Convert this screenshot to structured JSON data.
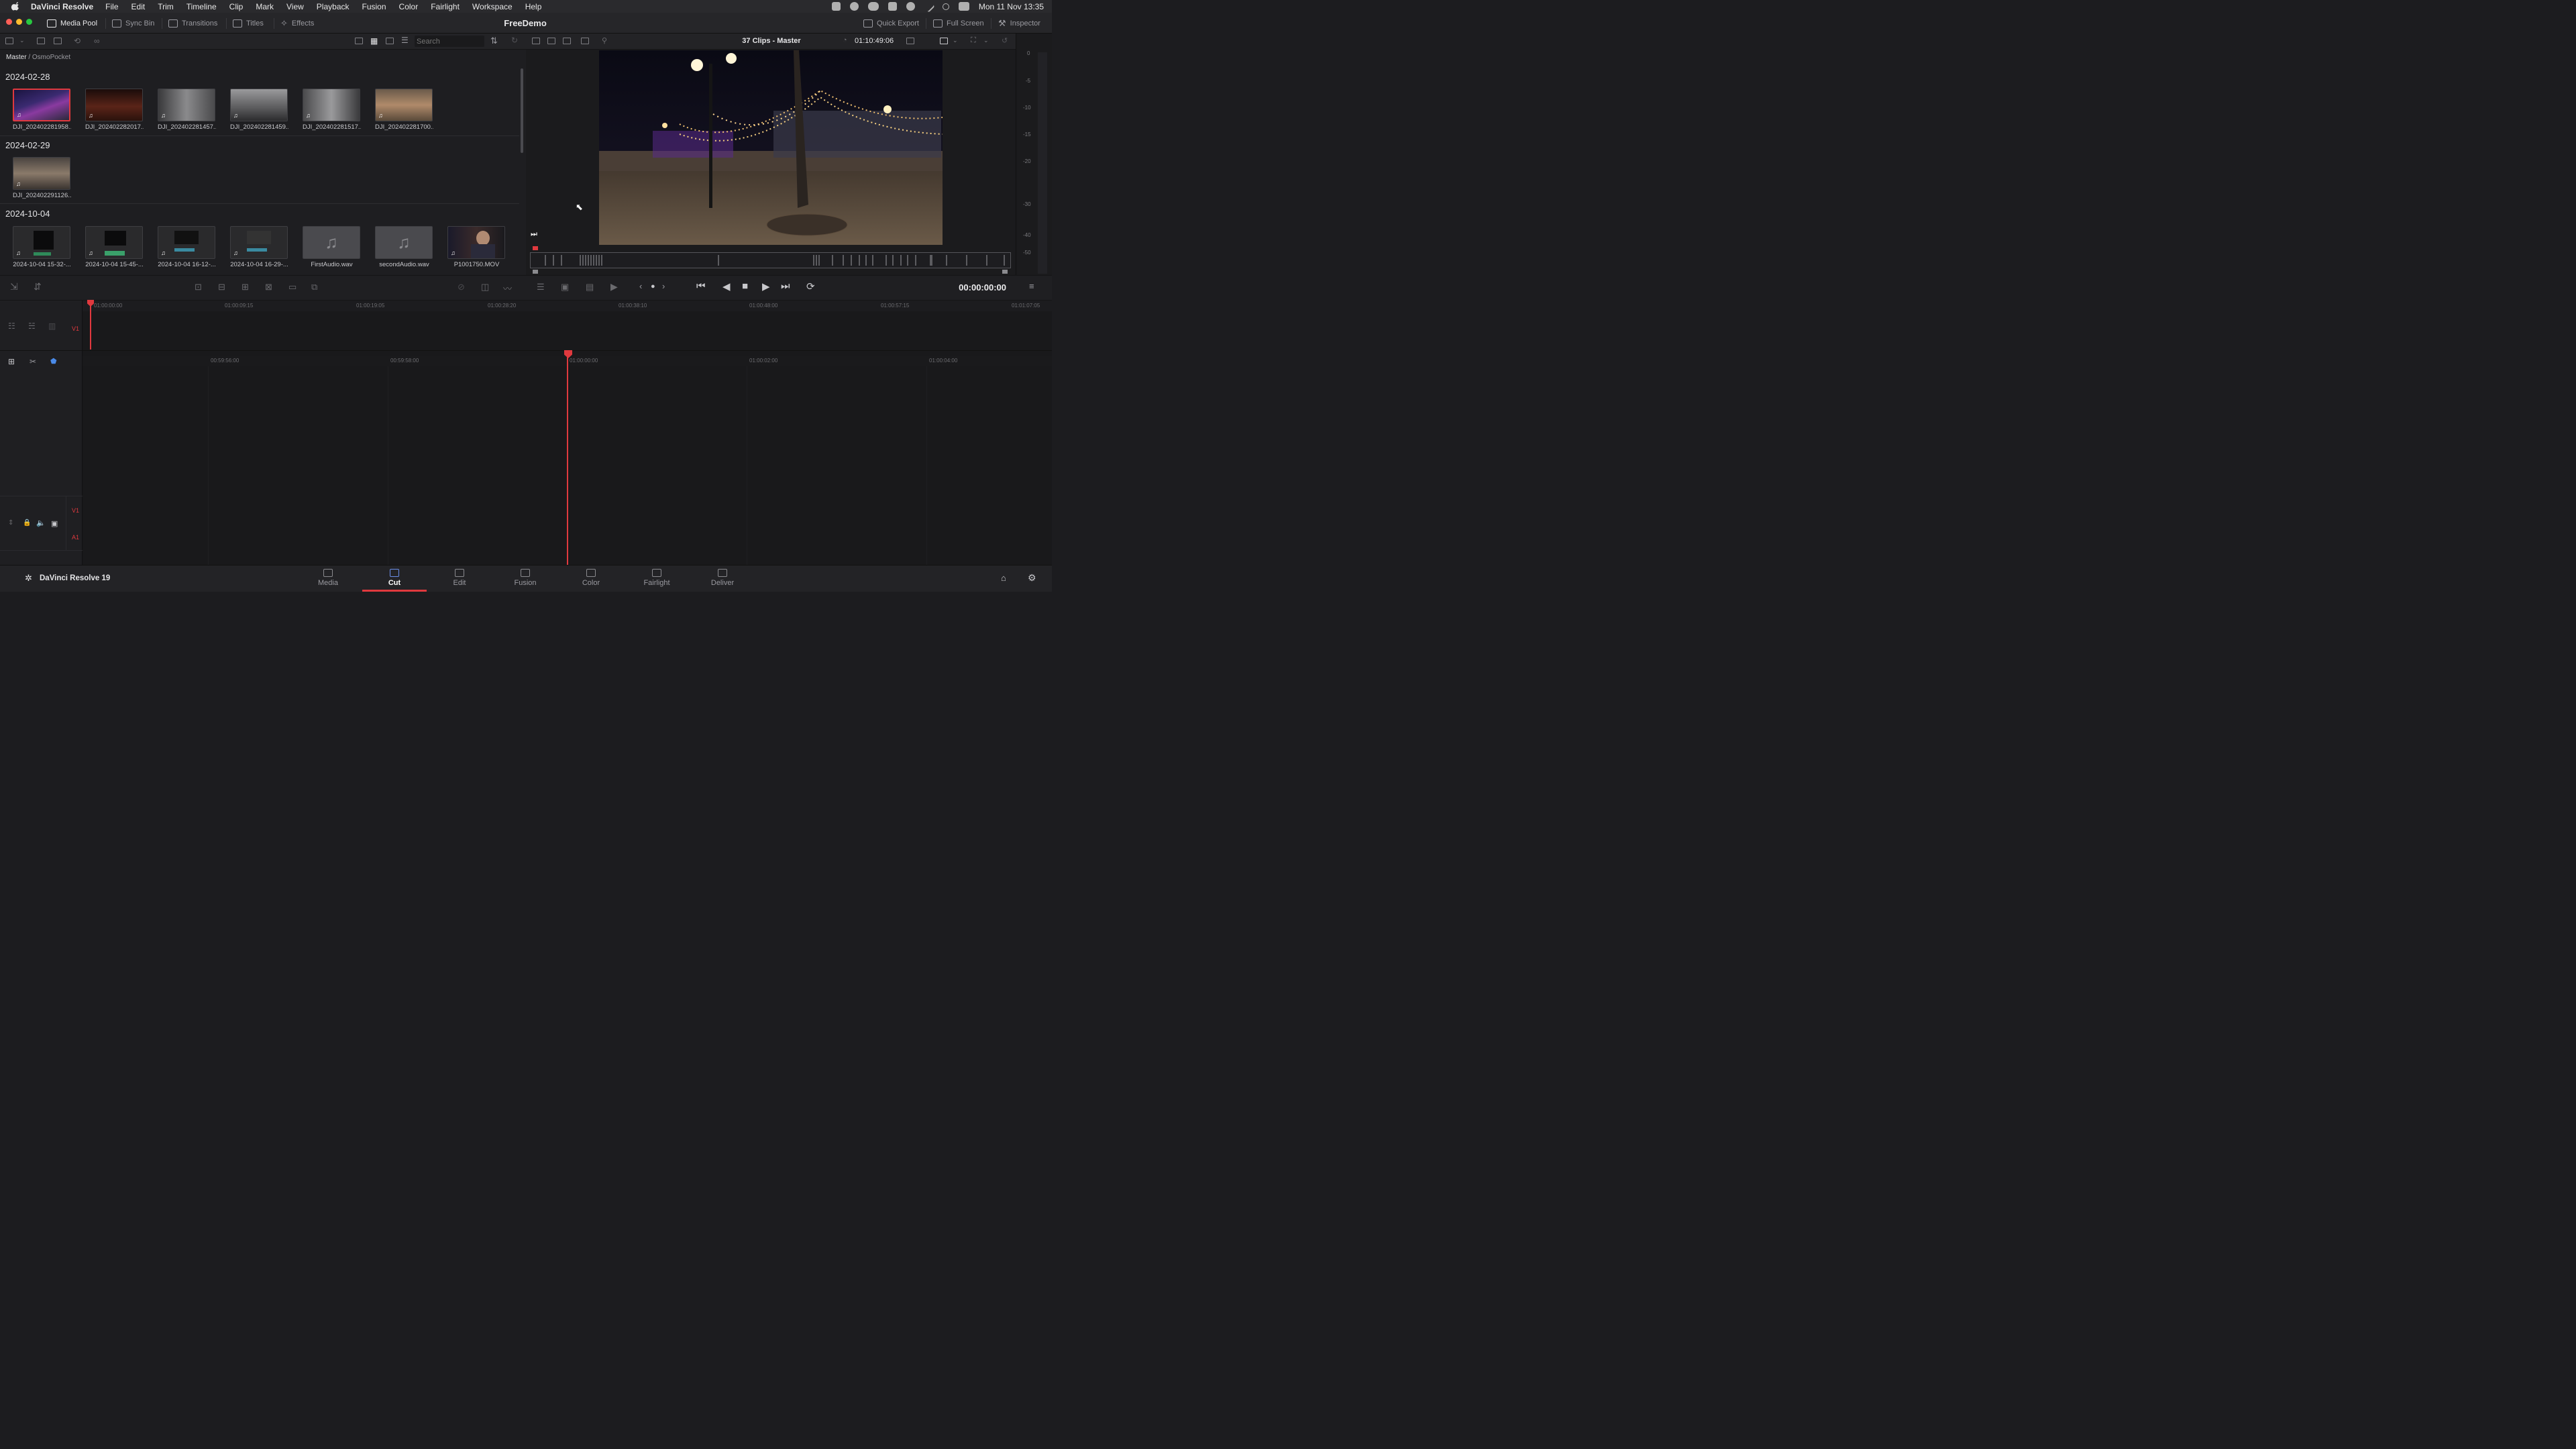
{
  "menubar": {
    "app": "DaVinci Resolve",
    "items": [
      "File",
      "Edit",
      "Trim",
      "Timeline",
      "Clip",
      "Mark",
      "View",
      "Playback",
      "Fusion",
      "Color",
      "Fairlight",
      "Workspace",
      "Help"
    ],
    "clock": "Mon 11 Nov  13:35"
  },
  "toolbar": {
    "media_pool": "Media Pool",
    "sync_bin": "Sync Bin",
    "transitions": "Transitions",
    "titles": "Titles",
    "effects": "Effects",
    "project_title": "FreeDemo",
    "quick_export": "Quick Export",
    "full_screen": "Full Screen",
    "inspector": "Inspector"
  },
  "pool": {
    "search_placeholder": "Search",
    "breadcrumb_root": "Master",
    "breadcrumb_sep": " / ",
    "breadcrumb_bin": "OsmoPocket",
    "groups": [
      {
        "date": "2024-02-28",
        "clips": [
          {
            "label": "DJI_202402281958...",
            "kind": "video",
            "selected": true
          },
          {
            "label": "DJI_202402282017...",
            "kind": "video"
          },
          {
            "label": "DJI_202402281457...",
            "kind": "video"
          },
          {
            "label": "DJI_202402281459...",
            "kind": "video"
          },
          {
            "label": "DJI_202402281517...",
            "kind": "video"
          },
          {
            "label": "DJI_202402281700...",
            "kind": "video"
          }
        ]
      },
      {
        "date": "2024-02-29",
        "clips": [
          {
            "label": "DJI_202402291126...",
            "kind": "video"
          }
        ]
      },
      {
        "date": "2024-10-04",
        "clips": [
          {
            "label": "2024-10-04 15-32-...",
            "kind": "screen"
          },
          {
            "label": "2024-10-04 15-45-...",
            "kind": "screen"
          },
          {
            "label": "2024-10-04 16-12-...",
            "kind": "screen"
          },
          {
            "label": "2024-10-04 16-29-...",
            "kind": "screen"
          },
          {
            "label": "FirstAudio.wav",
            "kind": "audio"
          },
          {
            "label": "secondAudio.wav",
            "kind": "audio"
          },
          {
            "label": "P1001750.MOV",
            "kind": "video"
          }
        ]
      }
    ]
  },
  "viewer": {
    "title": "37 Clips - Master",
    "timecode": "01:10:49:06",
    "playhead_timecode": "00:00:00:00"
  },
  "meter_ticks": [
    "0",
    "-5",
    "-10",
    "-15",
    "-20",
    "-30",
    "-40",
    "-50"
  ],
  "timeline": {
    "upper_ruler": [
      "01:00:00:00",
      "01:00:09:15",
      "01:00:19:05",
      "01:00:28:20",
      "01:00:38:10",
      "01:00:48:00",
      "01:00:57:15",
      "01:01:07:05"
    ],
    "lower_ruler": [
      "00:59:56:00",
      "00:59:58:00",
      "01:00:00:00",
      "01:00:02:00",
      "01:00:04:00"
    ],
    "track_v1": "V1",
    "track_a1": "A1"
  },
  "pages": {
    "brand": "DaVinci Resolve 19",
    "items": [
      "Media",
      "Cut",
      "Edit",
      "Fusion",
      "Color",
      "Fairlight",
      "Deliver"
    ],
    "active": "Cut"
  },
  "colors": {
    "accent_red": "#e0393e",
    "accent_blue": "#6a8ee8",
    "panel": "#1e1e21"
  }
}
